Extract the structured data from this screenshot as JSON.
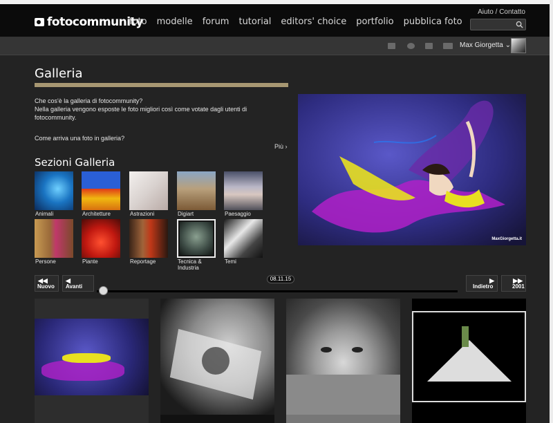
{
  "header": {
    "logo_text": "fotocommunity",
    "nav": [
      "foto",
      "modelle",
      "forum",
      "tutorial",
      "editors' choice",
      "portfolio",
      "pubblica foto"
    ],
    "help": "Aiuto / Contatto",
    "search_placeholder": ""
  },
  "subbar": {
    "user_name": "Max Giorgetta",
    "icons": [
      "mail-icon",
      "notification-icon",
      "chat-icon",
      "friends-icon"
    ]
  },
  "galleria": {
    "title": "Galleria",
    "intro_q": "Che cos'è la galleria di fotocommunity?",
    "intro_a": "Nella galleria vengono esposte le foto migliori così come votate dagli utenti di fotocommunity.",
    "howto": "Come arriva una foto in galleria?",
    "more": "Più"
  },
  "sections": {
    "title": "Sezioni Galleria",
    "items": [
      {
        "label": "Animali"
      },
      {
        "label": "Architetture"
      },
      {
        "label": "Astrazioni"
      },
      {
        "label": "Digiart"
      },
      {
        "label": "Paesaggio"
      },
      {
        "label": "Persone"
      },
      {
        "label": "Piante"
      },
      {
        "label": "Reportage"
      },
      {
        "label": "Tecnica & Industria"
      },
      {
        "label": "Temi"
      }
    ]
  },
  "hero": {
    "signature": "MaxGiorgetta.it"
  },
  "timeline": {
    "newest": "Nuovo",
    "forward": "Avanti",
    "back": "Indietro",
    "oldest": "2001",
    "date": "08.11.15"
  },
  "colors": {
    "accent_bar": "#a79772",
    "background": "#232323"
  }
}
